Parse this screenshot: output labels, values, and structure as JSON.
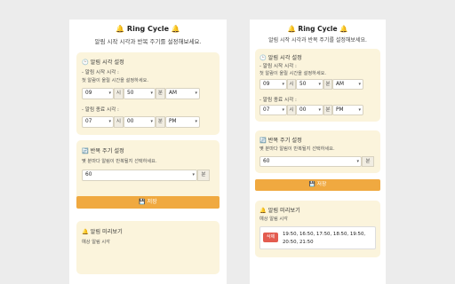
{
  "app": {
    "title": "🔔 Ring Cycle 🔔",
    "subtitle": "알림 시작 시각과 반복 주기를 설정해보세요."
  },
  "alarm_time": {
    "section_title": "🕒 알림 시각 설정",
    "start_label": "- 알림 시작 시각 :",
    "start_hint": "첫 알람이 울릴 시간을 설정하세요.",
    "start": {
      "hour": "09",
      "minute": "50",
      "ampm": "AM"
    },
    "end_label": "- 알림 종료 시각 :",
    "end": {
      "hour": "07",
      "minute": "00",
      "ampm": "PM"
    },
    "hour_unit": "시",
    "minute_unit": "분"
  },
  "repeat": {
    "section_title": "🔄 반복 주기 설정",
    "hint": "몇 분마다 알림이 반복될지 선택하세요.",
    "value": "60",
    "unit": "분"
  },
  "save_button": "💾 저장",
  "preview": {
    "section_title": "🔔 알림 미리보기",
    "label": "예상 알림 시각",
    "delete_button": "삭제",
    "times_line1": "19:50, 16:50, 17:50, 18:50, 19:50,",
    "times_line2": "20:50, 21:50"
  },
  "icons": {
    "chevron": "chevron-down-icon"
  },
  "colors": {
    "section_bg": "#fbf4dc",
    "save_button": "#f0a940",
    "delete_button": "#e35c50"
  }
}
